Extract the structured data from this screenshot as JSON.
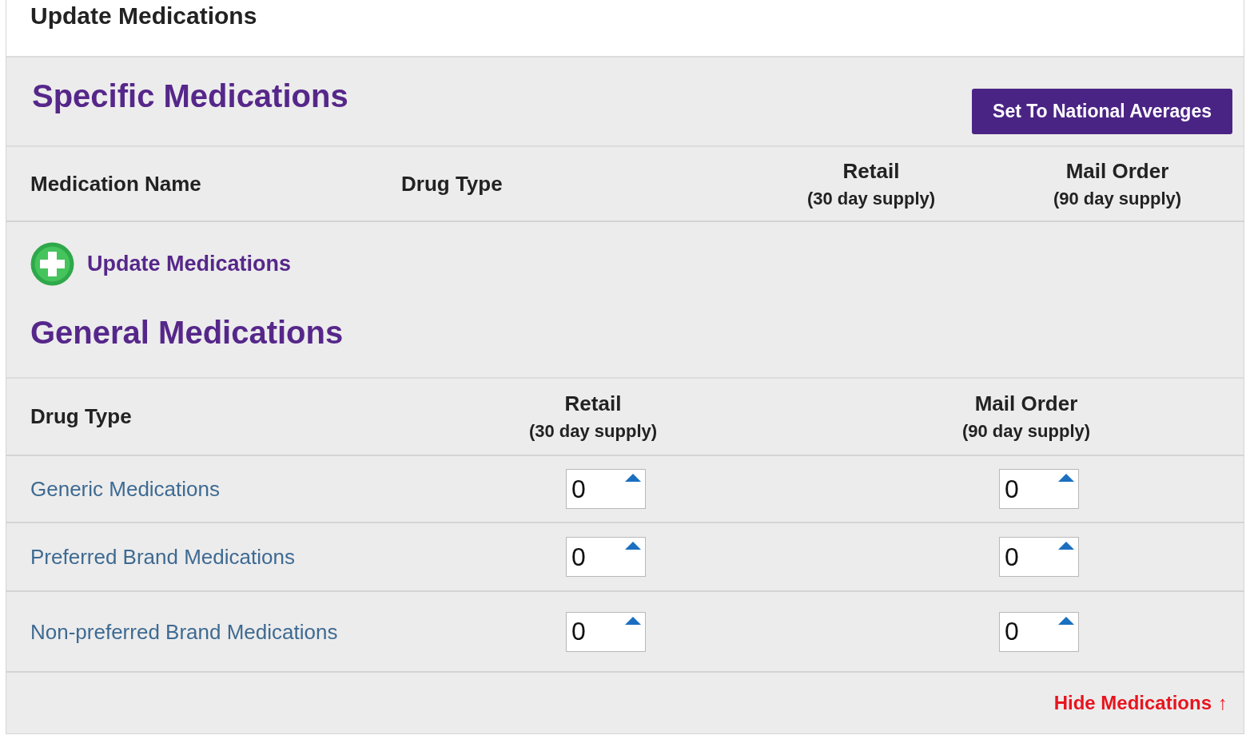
{
  "header": {
    "title": "Update Medications"
  },
  "specific": {
    "title": "Specific Medications",
    "button": "Set To National Averages",
    "columns": [
      {
        "label": "Medication Name"
      },
      {
        "label": "Drug Type"
      },
      {
        "label": "Retail",
        "sub": "(30 day supply)"
      },
      {
        "label": "Mail Order",
        "sub": "(90 day supply)"
      }
    ],
    "add_link": "Update Medications"
  },
  "general": {
    "title": "General Medications",
    "columns": [
      {
        "label": "Drug Type"
      },
      {
        "label": "Retail",
        "sub": "(30 day supply)"
      },
      {
        "label": "Mail Order",
        "sub": "(90 day supply)"
      }
    ],
    "rows": [
      {
        "name": "Generic Medications",
        "retail": "0",
        "mail": "0"
      },
      {
        "name": "Preferred Brand Medications",
        "retail": "0",
        "mail": "0"
      },
      {
        "name": "Non-preferred Brand Medications",
        "retail": "0",
        "mail": "0"
      }
    ]
  },
  "footer_link": {
    "label": "Hide Medications",
    "arrow": "↑"
  }
}
